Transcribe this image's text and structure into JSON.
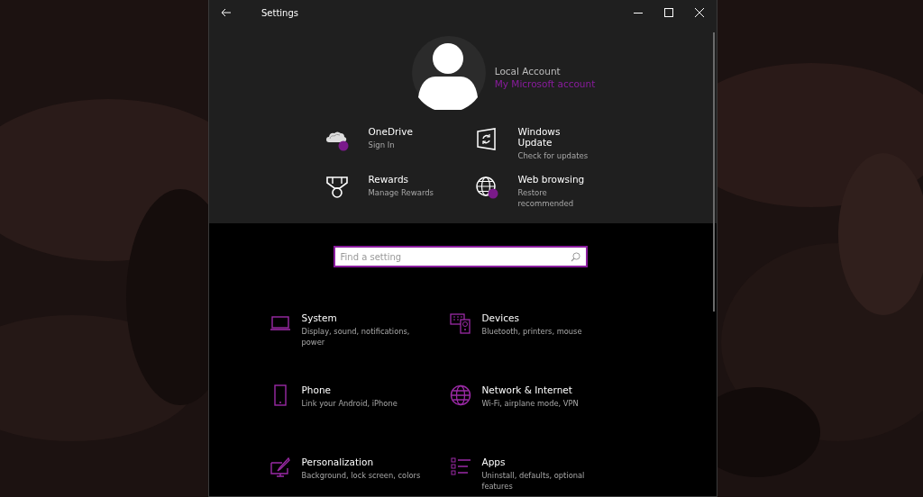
{
  "window": {
    "title": "Settings"
  },
  "account": {
    "name": "Local Account",
    "link": "My Microsoft account"
  },
  "quick_links": [
    {
      "kind": "cloud",
      "title": "OneDrive",
      "subtitle": "Sign In",
      "badge": true
    },
    {
      "kind": "update",
      "title": "Windows Update",
      "subtitle": "Check for updates",
      "badge": false
    },
    {
      "kind": "medal",
      "title": "Rewards",
      "subtitle": "Manage Rewards",
      "badge": false
    },
    {
      "kind": "globe",
      "title": "Web browsing",
      "subtitle": "Restore recommended",
      "badge": true
    }
  ],
  "search": {
    "placeholder": "Find a setting"
  },
  "categories": [
    {
      "kind": "laptop",
      "title": "System",
      "subtitle": "Display, sound, notifications, power"
    },
    {
      "kind": "devices",
      "title": "Devices",
      "subtitle": "Bluetooth, printers, mouse"
    },
    {
      "kind": "phone",
      "title": "Phone",
      "subtitle": "Link your Android, iPhone"
    },
    {
      "kind": "globe",
      "title": "Network & Internet",
      "subtitle": "Wi-Fi, airplane mode, VPN"
    },
    {
      "kind": "brush",
      "title": "Personalization",
      "subtitle": "Background, lock screen, colors"
    },
    {
      "kind": "list",
      "title": "Apps",
      "subtitle": "Uninstall, defaults, optional features"
    }
  ]
}
